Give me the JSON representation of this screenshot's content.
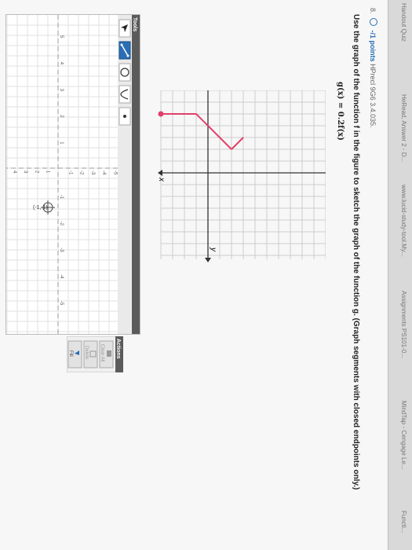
{
  "browser": {
    "tabs": [
      "Handout Quiz",
      "HeRead, Answer 2 - D...",
      "www.lucid-study-tool.My...",
      "Assignments PS101-0...",
      "MindTap - Cengage Le...",
      "Functi..."
    ]
  },
  "question": {
    "number": "8.",
    "points": "-/1 points",
    "code": "HPrecl 9G6 3.4.035.",
    "prompt": "Use the graph of the function f in the figure to sketch the graph of the function g. (Graph segments with closed endpoints only.)",
    "formula": "g(x) = 0.2f(x)"
  },
  "given_graph": {
    "x_label": "x",
    "y_label": "y",
    "segments": [
      {
        "x1": -3,
        "y1": 3,
        "x2": -2,
        "y2": 2
      },
      {
        "x1": -2,
        "y1": 2,
        "x2": 1,
        "y2": 5
      },
      {
        "x1": 1,
        "y1": 5,
        "x2": 4,
        "y2": 5
      }
    ],
    "closed_endpoint": {
      "x": 4,
      "y": 5
    },
    "colors": {
      "curve": "#e0406a",
      "grid": "#cccccc",
      "axis": "#333333"
    }
  },
  "tools_panel": {
    "title": "Tools",
    "tools": [
      {
        "icon": "pointer-arrow-icon"
      },
      {
        "icon": "line-segment-icon"
      },
      {
        "icon": "circle-icon"
      },
      {
        "icon": "parabola-icon"
      },
      {
        "icon": "point-icon"
      }
    ]
  },
  "answer_graph": {
    "x_ticks": [
      "-5",
      "-4",
      "-3",
      "-2",
      "-1",
      "1",
      "2",
      "3",
      "4",
      "5"
    ],
    "y_ticks": [
      "5",
      "4",
      "3",
      "2",
      "1",
      "-1",
      "-2",
      "-3",
      "-4",
      "-5"
    ],
    "cursor_label": "(-1, 1)"
  },
  "actions_panel": {
    "title": "Actions",
    "clear_all_label": "Clear All",
    "delete_label": "Delete",
    "fill_label": "Fill"
  }
}
